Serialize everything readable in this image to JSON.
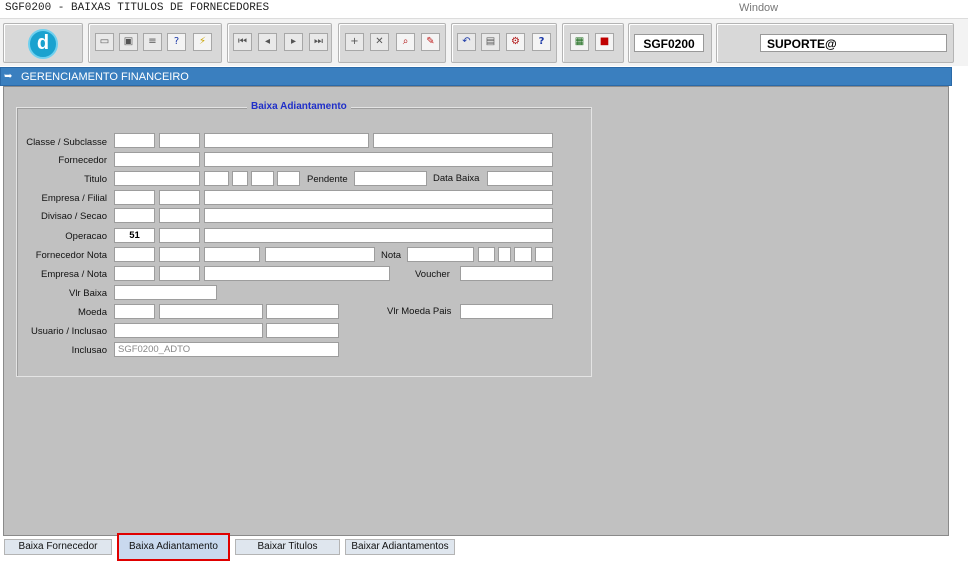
{
  "window": {
    "title": "SGF0200 - BAIXAS TITULOS DE FORNECEDORES",
    "menu_window": "Window"
  },
  "toolbar": {
    "program_code": "SGF0200",
    "user": "SUPORTE@",
    "icons": [
      "save-icon",
      "window-icon",
      "print-icon",
      "help-query-icon",
      "execute-query-icon",
      "first-record-icon",
      "previous-record-icon",
      "next-record-icon",
      "last-record-icon",
      "insert-record-icon",
      "delete-record-icon",
      "search-record-icon",
      "edit-icon",
      "undo-icon",
      "clipboard-icon",
      "tools-icon",
      "help-icon",
      "menu-icon",
      "exit-icon"
    ]
  },
  "header": {
    "title": "GERENCIAMENTO FINANCEIRO"
  },
  "form": {
    "group_title": "Baixa Adiantamento",
    "labels": {
      "classe_subclasse": "Classe / Subclasse",
      "fornecedor": "Fornecedor",
      "titulo": "Titulo",
      "pendente": "Pendente",
      "data_baixa": "Data Baixa",
      "empresa_filial": "Empresa / Filial",
      "divisao_secao": "Divisao / Secao",
      "operacao": "Operacao",
      "fornecedor_nota": "Fornecedor Nota",
      "nota": "Nota",
      "empresa_nota": "Empresa / Nota",
      "voucher": "Voucher",
      "vlr_baixa": "Vlr Baixa",
      "moeda": "Moeda",
      "vlr_moeda_pais": "Vlr Moeda Pais",
      "usuario_inclusao": "Usuario / Inclusao",
      "inclusao": "Inclusao"
    },
    "values": {
      "operacao": "51",
      "inclusao": "SGF0200_ADTO"
    }
  },
  "tabs": [
    {
      "label": "Baixa Fornecedor"
    },
    {
      "label": "Baixa Adiantamento"
    },
    {
      "label": "Baixar Titulos"
    },
    {
      "label": "Baixar Adiantamentos"
    }
  ]
}
